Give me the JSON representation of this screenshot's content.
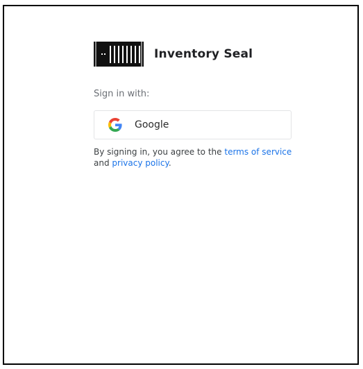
{
  "app": {
    "name": "Inventory Seal",
    "logo_icon": "container-logo-icon"
  },
  "signin": {
    "label": "Sign in with:",
    "google_button_label": "Google",
    "google_icon": "google-g-icon"
  },
  "terms": {
    "prefix": "By signing in, you agree to the ",
    "terms_link": "terms of service",
    "middle": " and ",
    "privacy_link": "privacy policy",
    "suffix": "."
  },
  "colors": {
    "link": "#1a73e8",
    "text": "#202124",
    "muted": "#6b6f75",
    "border": "#e3e4e6",
    "frame": "#000000"
  }
}
